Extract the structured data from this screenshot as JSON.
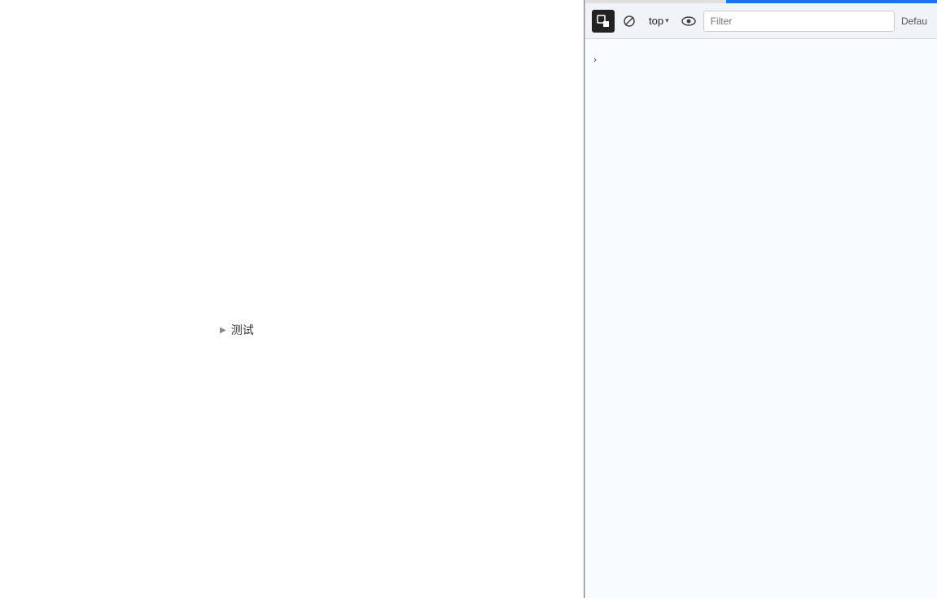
{
  "browser": {
    "content_text": "测试",
    "expand_arrow": "▶"
  },
  "devtools": {
    "toolbar": {
      "inspect_title": "Select an element in the page to inspect it",
      "clear_title": "Clear console",
      "context_label": "top",
      "dropdown_arrow": "▾",
      "filter_placeholder": "Filter",
      "default_label": "Defau"
    },
    "console": {
      "chevron": "›"
    }
  },
  "progress": {
    "fill_width_percent": 60
  }
}
